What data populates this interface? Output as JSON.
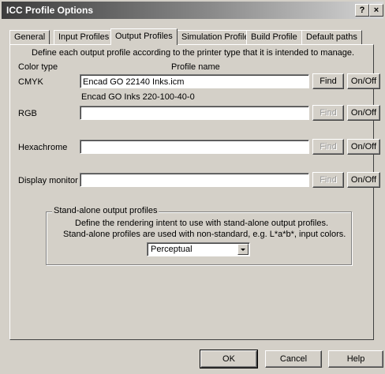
{
  "window": {
    "title": "ICC Profile Options",
    "help_glyph": "?",
    "close_glyph": "×"
  },
  "tabs": [
    {
      "label": "General"
    },
    {
      "label": "Input Profiles"
    },
    {
      "label": "Output Profiles",
      "active": true
    },
    {
      "label": "Simulation Profile"
    },
    {
      "label": "Build Profile"
    },
    {
      "label": "Default paths"
    }
  ],
  "panel": {
    "description": "Define each output profile according to the printer type that it is intended to manage.",
    "col_color_type": "Color type",
    "col_profile_name": "Profile name"
  },
  "rows": [
    {
      "label": "CMYK",
      "value": "Encad GO 22140 Inks.icm",
      "sub": "Encad GO Inks 220-100-40-0",
      "find": "Find",
      "onoff": "On/Off",
      "find_enabled": true
    },
    {
      "label": "RGB",
      "value": "",
      "find": "Find",
      "onoff": "On/Off",
      "find_enabled": false
    },
    {
      "label": "Hexachrome",
      "value": "",
      "find": "Find",
      "onoff": "On/Off",
      "find_enabled": false
    },
    {
      "label": "Display monitor",
      "value": "",
      "find": "Find",
      "onoff": "On/Off",
      "find_enabled": false
    }
  ],
  "standalone": {
    "group_label": "Stand-alone output profiles",
    "line1": "Define the rendering intent to use with stand-alone output profiles.",
    "line2": "Stand-alone profiles are used with non-standard, e.g. L*a*b*, input colors.",
    "selected": "Perceptual"
  },
  "footer": {
    "ok": "OK",
    "cancel": "Cancel",
    "help": "Help"
  }
}
